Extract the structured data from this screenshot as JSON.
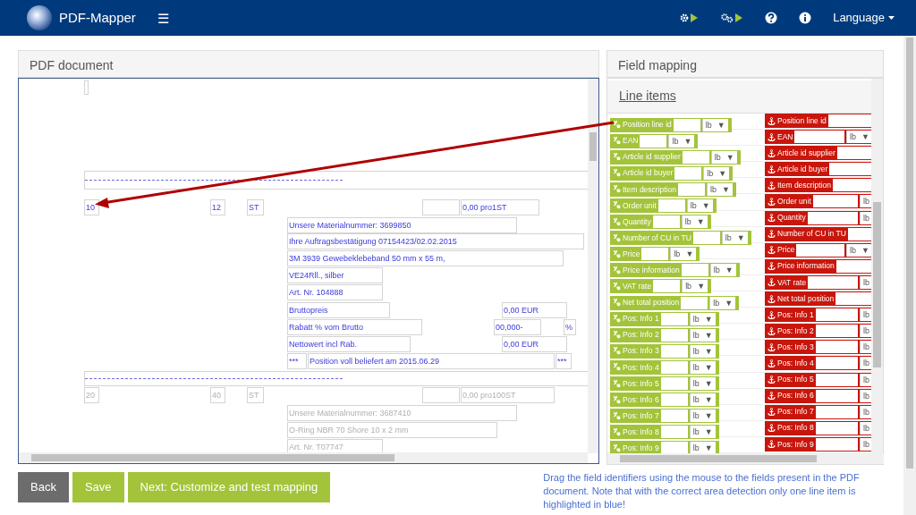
{
  "app": {
    "title": "PDF-Mapper",
    "menu_glyph": "☰",
    "language": "Language"
  },
  "pdf_panel": {
    "title": "PDF document",
    "boxes": [
      {
        "text": "10",
        "highlighted": true
      },
      {
        "text": "12",
        "highlighted": true
      },
      {
        "text": "ST",
        "highlighted": true
      },
      {
        "text": "0,00 pro1ST",
        "highlighted": true
      },
      {
        "text": "Unsere Materialnummer: 3699850",
        "highlighted": true
      },
      {
        "text": "Ihre Auftragsbestätigung 07154423/02.02.2015",
        "highlighted": true
      },
      {
        "text": "3M 3939 Gewebeklebeband 50 mm x 55 m,",
        "highlighted": true
      },
      {
        "text": "VE24Rll., silber",
        "highlighted": true
      },
      {
        "text": "Art. Nr. 104888",
        "highlighted": true
      },
      {
        "text": "Bruttopreis",
        "highlighted": true
      },
      {
        "text": "0,00 EUR",
        "highlighted": true
      },
      {
        "text": "Rabatt % vom Brutto",
        "highlighted": true
      },
      {
        "text": "00,000-",
        "highlighted": true
      },
      {
        "text": "%",
        "highlighted": true
      },
      {
        "text": "Nettowert incl Rab.",
        "highlighted": true
      },
      {
        "text": "0,00 EUR",
        "highlighted": true
      },
      {
        "text": "***",
        "highlighted": true
      },
      {
        "text": "Position voll beliefert am 2015.06.29",
        "highlighted": true
      },
      {
        "text": "***",
        "highlighted": true
      },
      {
        "text": "20",
        "highlighted": false
      },
      {
        "text": "40",
        "highlighted": false
      },
      {
        "text": "ST",
        "highlighted": false
      },
      {
        "text": "0,00 pro100ST",
        "highlighted": false
      },
      {
        "text": "Unsere Materialnummer: 3687410",
        "highlighted": false
      },
      {
        "text": "O-Ring NBR 70 Shore 10 x 2 mm",
        "highlighted": false
      },
      {
        "text": "Art. Nr. T07747",
        "highlighted": false
      }
    ]
  },
  "mapping_panel": {
    "title": "Field mapping",
    "section": "Line items",
    "rows": [
      {
        "source": {
          "label": "Position line id",
          "select": "lb",
          "caret": "▼"
        },
        "target": {
          "label": "Position line id"
        }
      },
      {
        "source": {
          "label": "EAN",
          "select": "lb",
          "caret": "▼"
        },
        "target": {
          "label": "EAN",
          "select": "lb",
          "caret": "▼"
        }
      },
      {
        "source": {
          "label": "Article id supplier",
          "select": "lb",
          "caret": "▼"
        },
        "target": {
          "label": "Article id supplier"
        }
      },
      {
        "source": {
          "label": "Article id buyer",
          "select": "lb",
          "caret": "▼"
        },
        "target": {
          "label": "Article id buyer"
        }
      },
      {
        "source": {
          "label": "Item description",
          "select": "lb",
          "caret": "▼"
        },
        "target": {
          "label": "Item description"
        }
      },
      {
        "source": {
          "label": "Order unit",
          "select": "lb",
          "caret": "▼"
        },
        "target": {
          "label": "Order unit",
          "select": "lb"
        }
      },
      {
        "source": {
          "label": "Quantity",
          "select": "lb",
          "caret": "▼"
        },
        "target": {
          "label": "Quantity",
          "select": "lb"
        }
      },
      {
        "source": {
          "label": "Number of CU in TU",
          "select": "lb",
          "caret": "▼"
        },
        "target": {
          "label": "Number of CU in TU"
        }
      },
      {
        "source": {
          "label": "Price",
          "select": "lb",
          "caret": "▼"
        },
        "target": {
          "label": "Price",
          "select": "lb",
          "caret": "▼"
        }
      },
      {
        "source": {
          "label": "Price information",
          "select": "lb",
          "caret": "▼"
        },
        "target": {
          "label": "Price information"
        }
      },
      {
        "source": {
          "label": "VAT rate",
          "select": "lb",
          "caret": "▼"
        },
        "target": {
          "label": "VAT rate",
          "select": "lb"
        }
      },
      {
        "source": {
          "label": "Net total position",
          "select": "lb",
          "caret": "▼"
        },
        "target": {
          "label": "Net total position"
        }
      },
      {
        "source": {
          "label": "Pos: Info 1",
          "select": "lb",
          "caret": "▼"
        },
        "target": {
          "label": "Pos: Info 1",
          "select": "lb"
        }
      },
      {
        "source": {
          "label": "Pos: Info 2",
          "select": "lb",
          "caret": "▼"
        },
        "target": {
          "label": "Pos: Info 2",
          "select": "lb"
        }
      },
      {
        "source": {
          "label": "Pos: Info 3",
          "select": "lb",
          "caret": "▼"
        },
        "target": {
          "label": "Pos: Info 3",
          "select": "lb"
        }
      },
      {
        "source": {
          "label": "Pos: Info 4",
          "select": "lb",
          "caret": "▼"
        },
        "target": {
          "label": "Pos: Info 4",
          "select": "lb"
        }
      },
      {
        "source": {
          "label": "Pos: Info 5",
          "select": "lb",
          "caret": "▼"
        },
        "target": {
          "label": "Pos: Info 5",
          "select": "lb"
        }
      },
      {
        "source": {
          "label": "Pos: Info 6",
          "select": "lb",
          "caret": "▼"
        },
        "target": {
          "label": "Pos: Info 6",
          "select": "lb"
        }
      },
      {
        "source": {
          "label": "Pos: Info 7",
          "select": "lb",
          "caret": "▼"
        },
        "target": {
          "label": "Pos: Info 7",
          "select": "lb"
        }
      },
      {
        "source": {
          "label": "Pos: Info 8",
          "select": "lb",
          "caret": "▼"
        },
        "target": {
          "label": "Pos: Info 8",
          "select": "lb"
        }
      },
      {
        "source": {
          "label": "Pos: Info 9",
          "select": "lb",
          "caret": "▼"
        },
        "target": {
          "label": "Pos: Info 9",
          "select": "lb"
        }
      }
    ]
  },
  "buttons": [
    {
      "label": "Back",
      "kind": "secondary"
    },
    {
      "label": "Save",
      "kind": "primary"
    },
    {
      "label": "Next: Customize and test mapping",
      "kind": "primary"
    }
  ],
  "help_text": "Drag the field identifiers using the mouse to the fields present in the PDF document. Note that with the correct area detection only one line item is highlighted in blue!"
}
